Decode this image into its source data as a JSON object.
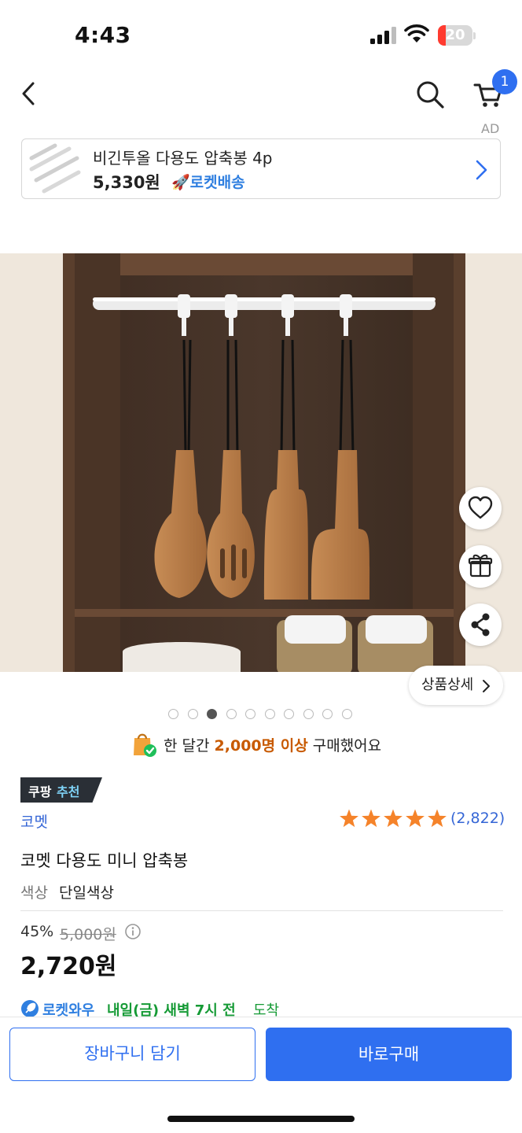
{
  "status_bar": {
    "time": "4:43",
    "battery_level": "20",
    "battery_color": "#ff3b30"
  },
  "nav": {
    "back_icon": "chevron-left-icon",
    "search_icon": "search-icon",
    "cart_icon": "cart-icon",
    "cart_count": "1"
  },
  "ad": {
    "label": "AD",
    "title": "비긴투올 다용도 압축봉 4p",
    "price": "5,330원",
    "delivery": "로켓배송",
    "chevron_icon": "chevron-right-icon"
  },
  "gallery": {
    "image": "wall-organizer-rod-with-hanging-wooden-utensils",
    "favorite_icon": "heart-icon",
    "gift_icon": "gift-icon",
    "share_icon": "share-icon",
    "detail_label": "상품상세",
    "total_dots": 10,
    "active_dot": 3
  },
  "sold": {
    "prefix": "한 달간",
    "highlight": "2,000명 이상",
    "suffix": "구매했어요",
    "highlight_color": "#c85a00"
  },
  "product": {
    "badge_a": "쿠팡",
    "badge_b": "추천",
    "brand": "코멧",
    "rating": 5,
    "review_count": "(2,822)",
    "name": "코멧 다용도 미니 압축봉",
    "option_label": "색상",
    "option_value": "단일색상",
    "discount": "45%",
    "original_price": "5,000원",
    "price": "2,720원",
    "delivery_brand": "로켓와우",
    "delivery_date": "내일(금) 새벽 7시 전",
    "delivery_suffix": "도착",
    "accent_color": "#2f6ff0"
  },
  "actions": {
    "cart_label": "장바구니 담기",
    "buy_label": "바로구매"
  }
}
